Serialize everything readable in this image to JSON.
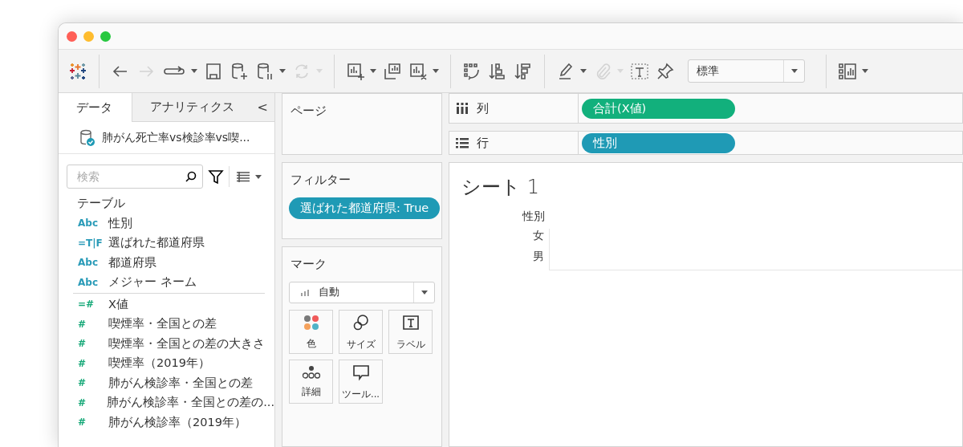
{
  "toolbar": {
    "buttons": [
      {
        "disabled": false,
        "menu": false
      },
      {
        "disabled": false,
        "menu": false
      },
      {
        "disabled": true,
        "menu": false
      },
      {
        "disabled": false,
        "menu": true
      },
      {
        "disabled": false,
        "menu": false
      },
      {
        "disabled": false,
        "menu": false
      },
      {
        "disabled": false,
        "menu": true
      },
      {
        "disabled": true,
        "menu": true
      },
      {
        "disabled": false,
        "menu": true
      },
      {
        "disabled": false,
        "menu": false
      },
      {
        "disabled": false,
        "menu": true
      },
      {
        "disabled": false,
        "menu": false
      },
      {
        "disabled": false,
        "menu": false
      },
      {
        "disabled": false,
        "menu": false
      },
      {
        "disabled": false,
        "menu": true
      },
      {
        "disabled": true,
        "menu": true
      },
      {
        "disabled": false,
        "menu": false
      },
      {
        "disabled": false,
        "menu": false
      }
    ],
    "view_select": {
      "value": "標準"
    },
    "show_me": {
      "menu": true
    }
  },
  "data_pane": {
    "tabs": [
      {
        "label": "データ",
        "selected": true
      },
      {
        "label": "アナリティクス",
        "selected": false
      }
    ],
    "collapse": "<",
    "datasource": "肺がん死亡率vs検診率vs喫...",
    "search": {
      "placeholder": "検索"
    },
    "section": "テーブル",
    "fields": [
      {
        "kind": "dimension",
        "icon": "Abc",
        "name": "性別"
      },
      {
        "kind": "dimension",
        "icon": "=T|F",
        "name": "選ばれた都道府県"
      },
      {
        "kind": "dimension",
        "icon": "Abc",
        "name": "都道府県"
      },
      {
        "kind": "dimension",
        "icon": "Abc",
        "name": "メジャー ネーム"
      },
      {
        "kind": "measure",
        "icon": "=#",
        "name": "X値"
      },
      {
        "kind": "measure",
        "icon": "#",
        "name": "喫煙率・全国との差"
      },
      {
        "kind": "measure",
        "icon": "#",
        "name": "喫煙率・全国との差の大きさ"
      },
      {
        "kind": "measure",
        "icon": "#",
        "name": "喫煙率（2019年）"
      },
      {
        "kind": "measure",
        "icon": "#",
        "name": "肺がん検診率・全国との差"
      },
      {
        "kind": "measure",
        "icon": "#",
        "name": "肺がん検診率・全国との差の..."
      },
      {
        "kind": "measure",
        "icon": "#",
        "name": "肺がん検診率（2019年）"
      }
    ]
  },
  "pages": {
    "title": "ページ"
  },
  "filters": {
    "title": "フィルター",
    "pills": [
      {
        "label": "選ばれた都道府県: True",
        "color": "#1f9ab5"
      }
    ]
  },
  "marks": {
    "title": "マーク",
    "type": "自動",
    "cards": [
      {
        "label": "色"
      },
      {
        "label": "サイズ"
      },
      {
        "label": "ラベル"
      },
      {
        "label": "詳細"
      },
      {
        "label": "ツール..."
      }
    ]
  },
  "shelves": [
    {
      "label": "列",
      "pills": [
        {
          "label": "合計(X値)",
          "color": "#12b07c"
        }
      ]
    },
    {
      "label": "行",
      "pills": [
        {
          "label": "性別",
          "color": "#1f9ab5"
        }
      ]
    }
  ],
  "sheet": {
    "title": "シート 1",
    "header": "性別",
    "rows": [
      "女",
      "男"
    ]
  }
}
